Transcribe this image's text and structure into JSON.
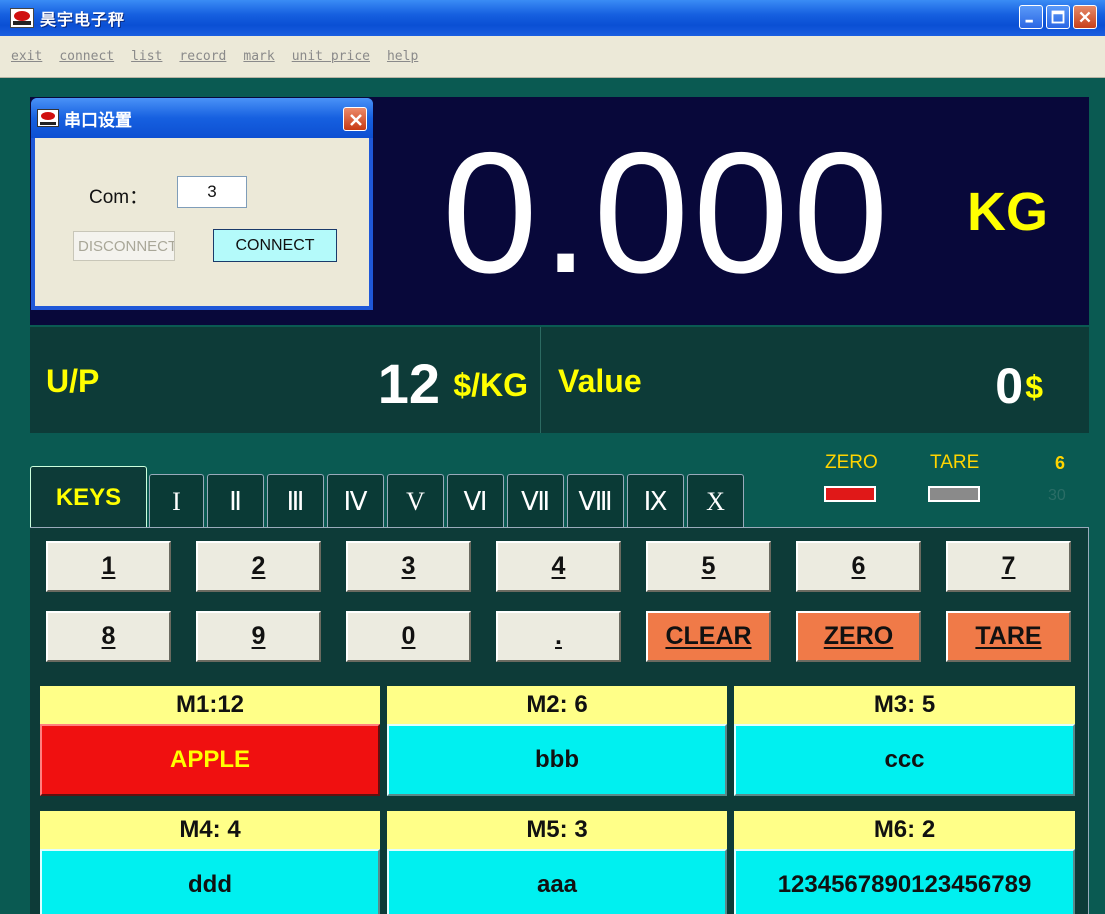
{
  "window": {
    "title": "昊宇电子秤"
  },
  "menu": [
    "exit",
    "connect",
    "list",
    "record",
    "mark",
    "unit price",
    "help"
  ],
  "display": {
    "weight": "0.000",
    "weight_unit": "KG",
    "unit_price_label": "U/P",
    "unit_price": "12",
    "unit_price_unit": "$/KG",
    "value_label": "Value",
    "value": "0",
    "value_unit": "$"
  },
  "indicators": {
    "zero_label": "ZERO",
    "zero_color": "#e01818",
    "tare_label": "TARE",
    "tare_color": "#8a8a8a",
    "count_a": "6",
    "count_b": "30"
  },
  "tabs": [
    "KEYS",
    "I",
    "Ⅱ",
    "Ⅲ",
    "Ⅳ",
    "V",
    "Ⅵ",
    "Ⅶ",
    "Ⅷ",
    "Ⅸ",
    "X"
  ],
  "keys": {
    "row1": [
      "1",
      "2",
      "3",
      "4",
      "5",
      "6",
      "7"
    ],
    "row2": [
      "8",
      "9",
      "0",
      ".",
      "CLEAR",
      "ZERO",
      "TARE"
    ]
  },
  "memory": [
    {
      "head": "M1:12",
      "name": "APPLE"
    },
    {
      "head": "M2: 6",
      "name": "bbb"
    },
    {
      "head": "M3: 5",
      "name": "ccc"
    },
    {
      "head": "M4: 4",
      "name": "ddd"
    },
    {
      "head": "M5: 3",
      "name": "aaa"
    },
    {
      "head": "M6: 2",
      "name": "1234567890123456789"
    }
  ],
  "dialog": {
    "title": "串口设置",
    "com_label": "Com：",
    "com_value": "3",
    "disconnect_label": "DISCONNECT",
    "connect_label": "CONNECT"
  }
}
